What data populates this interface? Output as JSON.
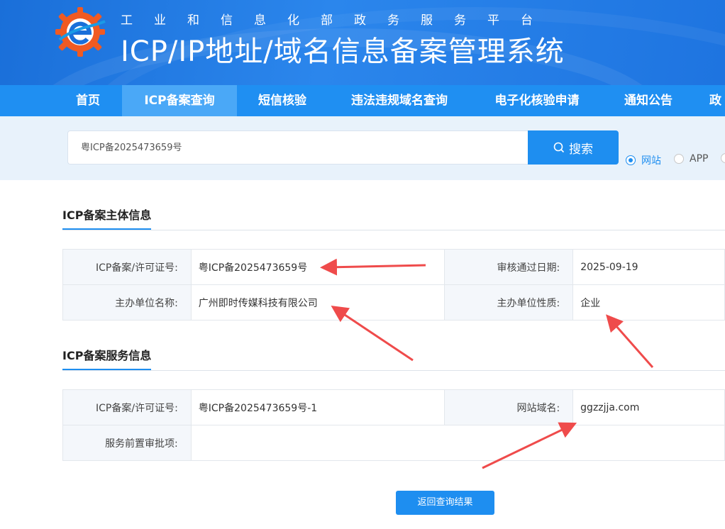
{
  "header": {
    "subtitle": "工业和信息化部政务服务平台",
    "title": "ICP/IP地址/域名信息备案管理系统"
  },
  "nav": {
    "items": [
      {
        "label": "首页"
      },
      {
        "label": "ICP备案查询",
        "active": true
      },
      {
        "label": "短信核验"
      },
      {
        "label": "违法违规域名查询"
      },
      {
        "label": "电子化核验申请"
      },
      {
        "label": "通知公告"
      },
      {
        "label": "政"
      }
    ]
  },
  "search": {
    "value": "粤ICP备2025473659号",
    "button_label": "搜索",
    "options": [
      {
        "label": "网站",
        "selected": true
      },
      {
        "label": "APP",
        "selected": false
      }
    ]
  },
  "subject_info": {
    "title": "ICP备案主体信息",
    "rows": [
      {
        "k1": "ICP备案/许可证号:",
        "v1": "粤ICP备2025473659号",
        "k2": "审核通过日期:",
        "v2": "2025-09-19"
      },
      {
        "k1": "主办单位名称:",
        "v1": "广州即时传媒科技有限公司",
        "k2": "主办单位性质:",
        "v2": "企业"
      }
    ]
  },
  "service_info": {
    "title": "ICP备案服务信息",
    "rows": [
      {
        "k1": "ICP备案/许可证号:",
        "v1": "粤ICP备2025473659号-1",
        "k2": "网站域名:",
        "v2": "ggzzjja.com"
      },
      {
        "k1": "服务前置审批项:",
        "v1": ""
      }
    ]
  },
  "back_button_label": "返回查询结果",
  "colors": {
    "primary": "#1e8ef0",
    "nav_bg": "#1f8ff2",
    "annotation_arrow": "#ef4b4b"
  }
}
